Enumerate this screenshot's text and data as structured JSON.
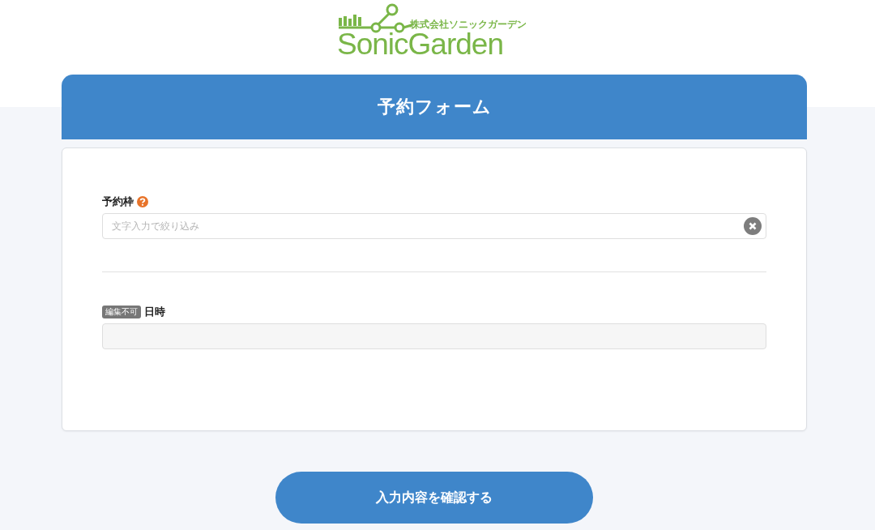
{
  "logo": {
    "company": "株式会社ソニックガーデン",
    "name": "SonicGarden"
  },
  "form": {
    "title": "予約フォーム",
    "fields": [
      {
        "kind": "search",
        "label": "予約枠",
        "help": true,
        "placeholder": "文字入力で絞り込み",
        "clearable": true
      },
      {
        "kind": "readonly",
        "label": "日時",
        "badge": "編集不可"
      }
    ]
  },
  "submit": "入力内容を確認する"
}
